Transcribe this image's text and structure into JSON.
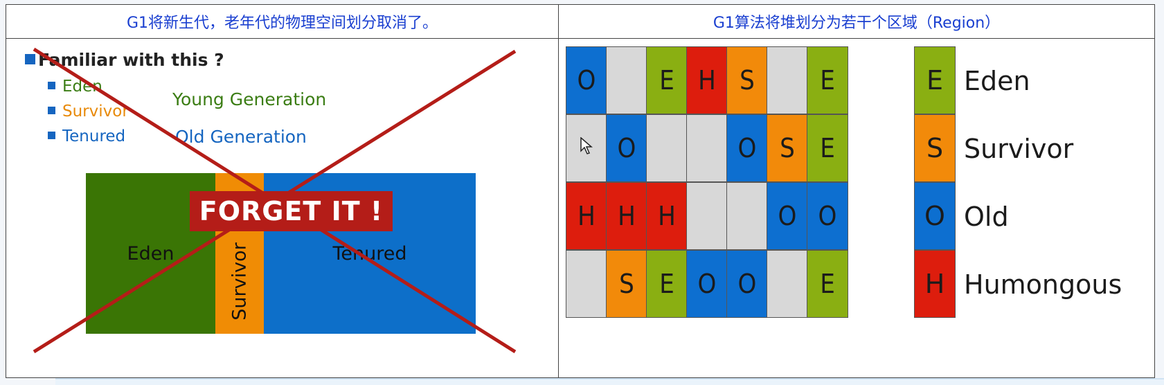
{
  "headers": {
    "left": "G1将新生代，老年代的物理空间划分取消了。",
    "right": "G1算法将堆划分为若干个区域（Region）"
  },
  "left": {
    "question": "Familiar with this ?",
    "bullets": [
      "Eden",
      "Survivor",
      "Tenured"
    ],
    "young_label": "Young Generation",
    "old_label": "Old Generation",
    "blocks": {
      "eden": "Eden",
      "survivor": "Survivor",
      "tenured": "Tenured"
    },
    "stamp": "FORGET IT !"
  },
  "grid": {
    "rows": [
      [
        "O",
        "",
        "E",
        "H",
        "S",
        "",
        "E"
      ],
      [
        "",
        "O",
        "",
        "",
        "O",
        "S",
        "E"
      ],
      [
        "H",
        "H",
        "H",
        "",
        "",
        "O",
        "O"
      ],
      [
        "",
        "S",
        "E",
        "O",
        "O",
        "",
        "E"
      ]
    ]
  },
  "legend": [
    {
      "key": "E",
      "label": "Eden"
    },
    {
      "key": "S",
      "label": "Survivor"
    },
    {
      "key": "O",
      "label": "Old"
    },
    {
      "key": "H",
      "label": "Humongous"
    }
  ],
  "colors": {
    "E": "#8aaf12",
    "S": "#f28a0a",
    "O": "#0d6fd0",
    "H": "#dd1d0d",
    "empty": "#d8d8d8",
    "header_text": "#1a3fd0",
    "cross": "#b41d18",
    "eden_block": "#3a7505",
    "survivor_block": "#f08c05",
    "tenured_block": "#0d6fc9"
  }
}
